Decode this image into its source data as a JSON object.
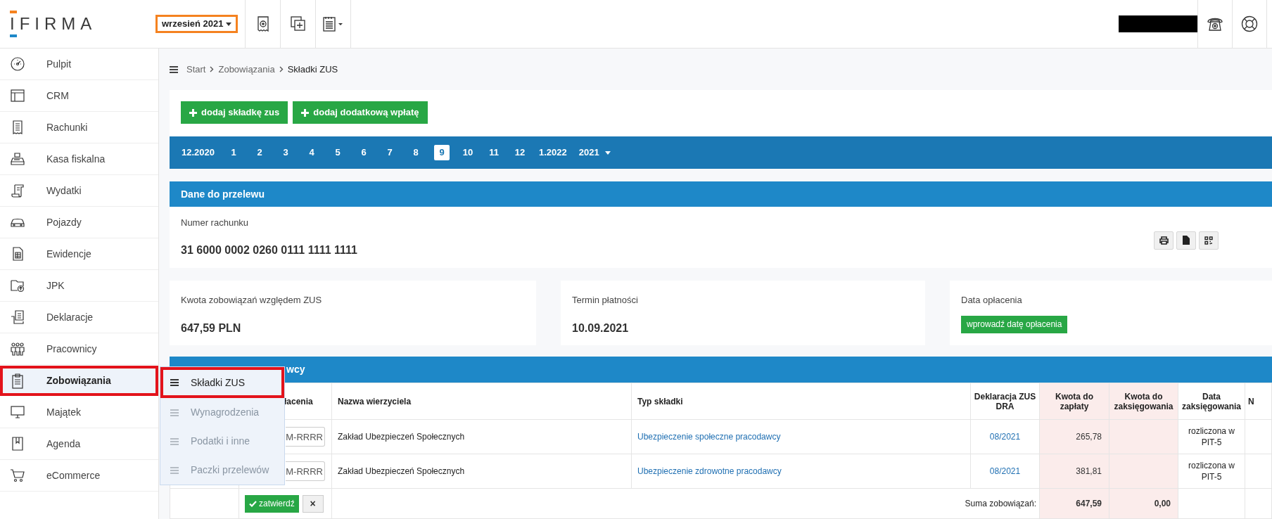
{
  "header": {
    "logo": "IFIRMA",
    "period": "wrzesień 2021"
  },
  "sidebar": {
    "items": [
      {
        "label": "Pulpit",
        "selected": false
      },
      {
        "label": "CRM",
        "selected": false
      },
      {
        "label": "Rachunki",
        "selected": false
      },
      {
        "label": "Kasa fiskalna",
        "selected": false
      },
      {
        "label": "Wydatki",
        "selected": false
      },
      {
        "label": "Pojazdy",
        "selected": false
      },
      {
        "label": "Ewidencje",
        "selected": false
      },
      {
        "label": "JPK",
        "selected": false
      },
      {
        "label": "Deklaracje",
        "selected": false
      },
      {
        "label": "Pracownicy",
        "selected": false
      },
      {
        "label": "Zobowiązania",
        "selected": true
      },
      {
        "label": "Majątek",
        "selected": false
      },
      {
        "label": "Agenda",
        "selected": false
      },
      {
        "label": "eCommerce",
        "selected": false
      }
    ],
    "flyout": [
      {
        "label": "Składki ZUS",
        "selected": true
      },
      {
        "label": "Wynagrodzenia",
        "selected": false
      },
      {
        "label": "Podatki i inne",
        "selected": false
      },
      {
        "label": "Paczki przelewów",
        "selected": false
      }
    ]
  },
  "breadcrumb": [
    "Start",
    "Zobowiązania",
    "Składki ZUS"
  ],
  "actions": [
    "dodaj składkę zus",
    "dodaj dodatkową wpłatę"
  ],
  "months": [
    {
      "label": "12.2020",
      "kind": "month",
      "selected": false
    },
    {
      "label": "1",
      "kind": "month",
      "selected": false
    },
    {
      "label": "2",
      "kind": "month",
      "selected": false
    },
    {
      "label": "3",
      "kind": "month",
      "selected": false
    },
    {
      "label": "4",
      "kind": "month",
      "selected": false
    },
    {
      "label": "5",
      "kind": "month",
      "selected": false
    },
    {
      "label": "6",
      "kind": "month",
      "selected": false
    },
    {
      "label": "7",
      "kind": "month",
      "selected": false
    },
    {
      "label": "8",
      "kind": "month",
      "selected": false
    },
    {
      "label": "9",
      "kind": "month",
      "selected": true
    },
    {
      "label": "10",
      "kind": "month",
      "selected": false
    },
    {
      "label": "11",
      "kind": "month",
      "selected": false
    },
    {
      "label": "12",
      "kind": "month",
      "selected": false
    },
    {
      "label": "1.2022",
      "kind": "month",
      "selected": false
    },
    {
      "label": "2021",
      "kind": "year",
      "selected": false
    }
  ],
  "transfer": {
    "title": "Dane do przelewu",
    "account_label": "Numer rachunku",
    "account_number": "31 6000 0002 0260 0111 1111 1111"
  },
  "summary": [
    {
      "label": "Kwota zobowiązań względem ZUS",
      "value": "647,59 PLN"
    },
    {
      "label": "Termin płatności",
      "value": "10.09.2021"
    },
    {
      "label": "Data opłacenia",
      "button": "wprowadź datę opłacenia"
    }
  ],
  "table": {
    "title": "wcy",
    "columns": [
      "łacenia",
      "Nazwa wierzyciela",
      "Typ składki",
      "Deklaracja ZUS DRA",
      "Kwota do zapłaty",
      "Kwota do zaksięgowania",
      "Data zaksięgowania",
      "N"
    ],
    "rows": [
      {
        "date_placeholder": "M-RRRR",
        "creditor": "Zakład Ubezpieczeń Społecznych",
        "type": "Ubezpieczenie społeczne pracodawcy",
        "declaration": "08/2021",
        "amount": "265,78",
        "booking": "rozliczona w PIT-5"
      },
      {
        "date_placeholder": "M-RRRR",
        "creditor": "Zakład Ubezpieczeń Społecznych",
        "type": "Ubezpieczenie zdrowotne pracodawcy",
        "declaration": "08/2021",
        "amount": "381,81",
        "booking": "rozliczona w PIT-5"
      }
    ],
    "footer": {
      "confirm": "zatwierdź",
      "cancel": "×",
      "sum_label": "Suma zobowiązań:",
      "sum_to_pay": "647,59",
      "sum_to_book": "0,00"
    }
  }
}
